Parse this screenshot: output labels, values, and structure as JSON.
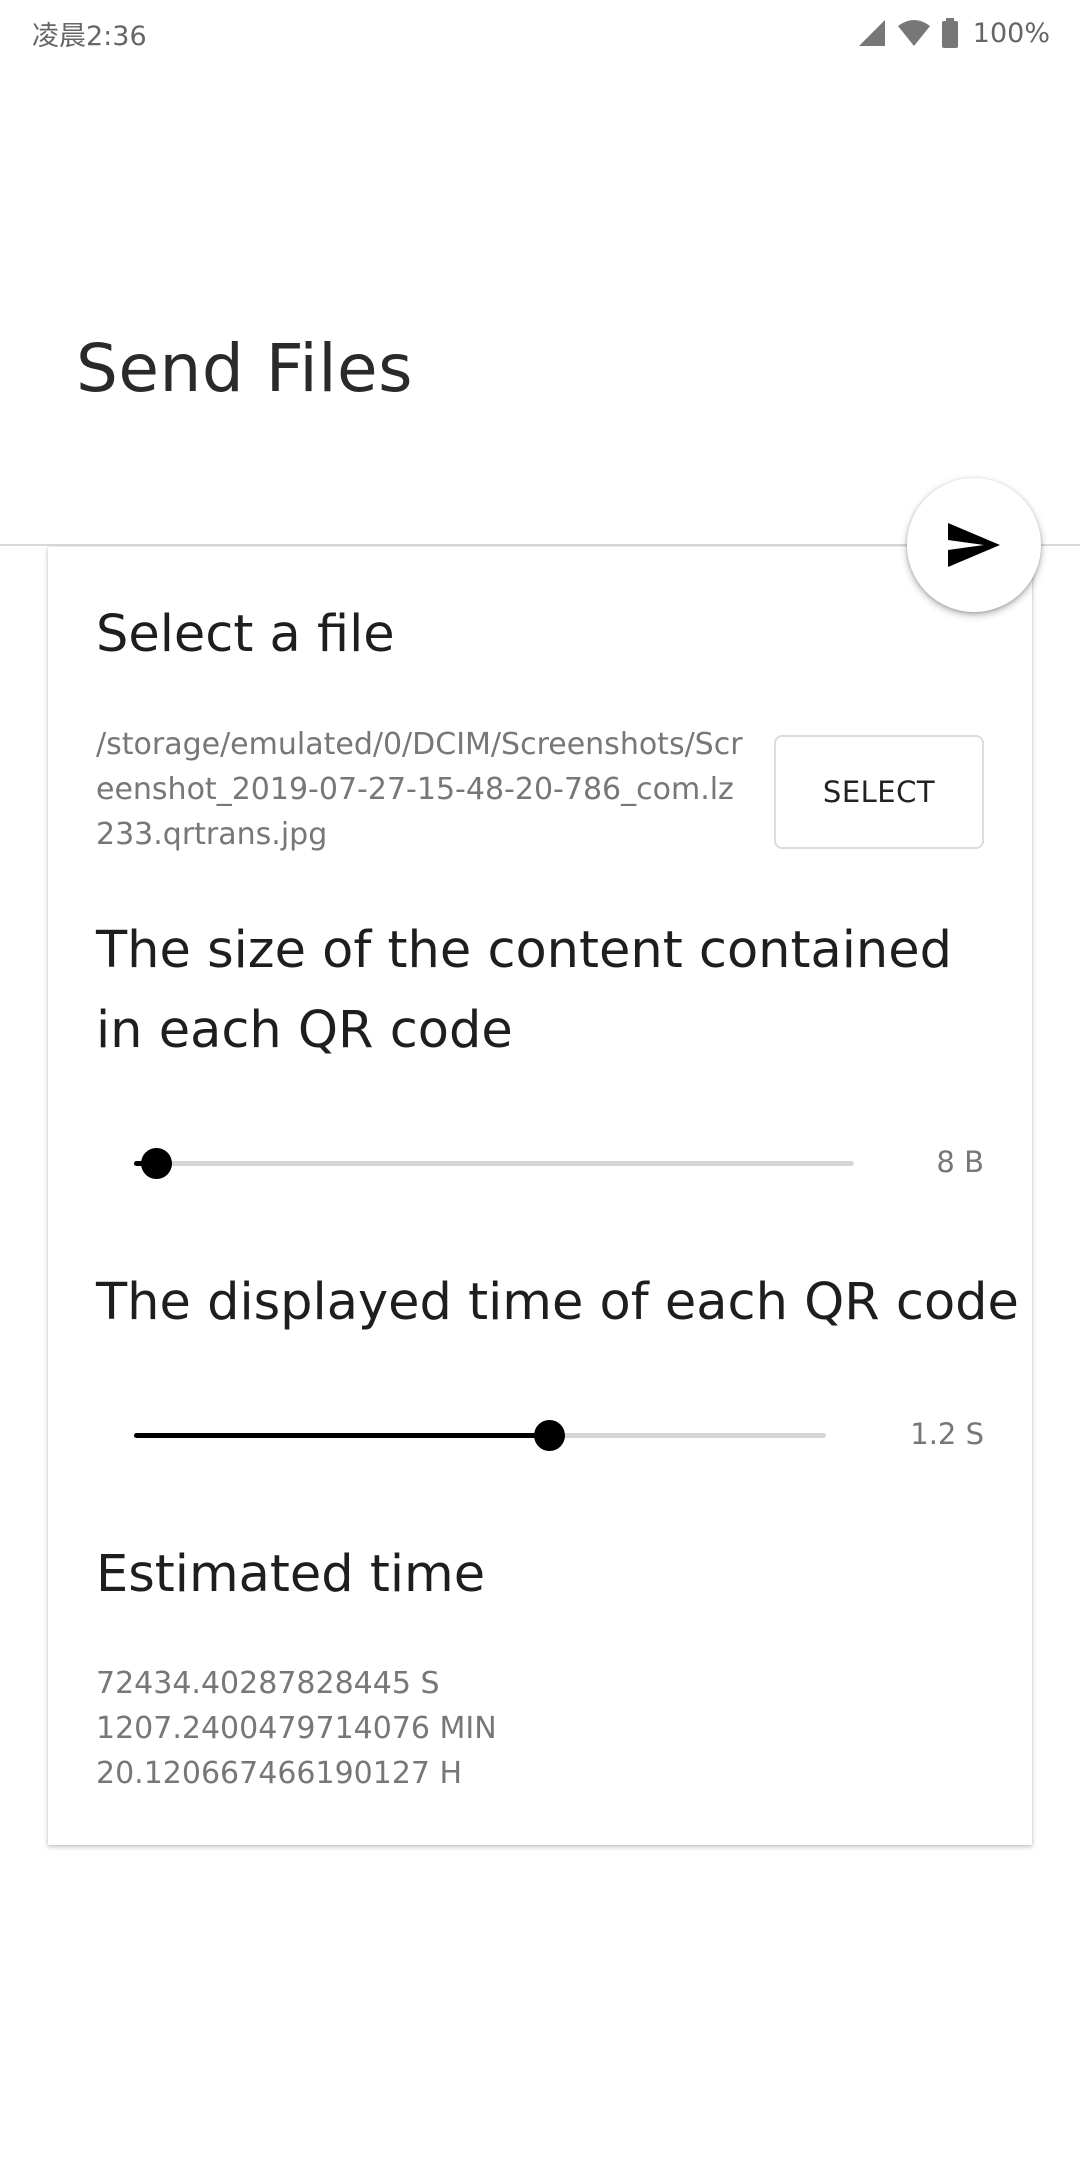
{
  "status_bar": {
    "time": "凌晨2:36",
    "battery": "100%"
  },
  "header": {
    "title": "Send Files"
  },
  "fab": {
    "icon": "send-icon"
  },
  "card": {
    "file_section": {
      "heading": "Select a file",
      "path": "/storage/emulated/0/DCIM/Screenshots/Screenshot_2019-07-27-15-48-20-786_com.lz233.qrtrans.jpg",
      "select_label": "SELECT"
    },
    "size_section": {
      "heading": "The size of the content contained in each QR code",
      "value_label": "8 B",
      "fraction": 0.03
    },
    "time_section": {
      "heading": "The displayed time of each QR code",
      "value_label": "1.2 S",
      "fraction": 0.6
    },
    "estimate_section": {
      "heading": "Estimated time",
      "seconds": "72434.40287828445 S",
      "minutes": "1207.2400479714076 MIN",
      "hours": "20.120667466190127 H"
    }
  },
  "colors": {
    "accent": "#000000",
    "track": "#d6d6d6",
    "secondary_text": "#777777"
  }
}
